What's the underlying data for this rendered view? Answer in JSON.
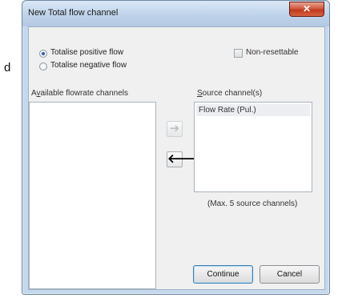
{
  "background_text": "d",
  "dialog": {
    "title": "New Total flow channel",
    "close_glyph": "✕",
    "radio_options": [
      {
        "label": "Totalise positive flow",
        "selected": true
      },
      {
        "label": "Totalise negative flow",
        "selected": false
      }
    ],
    "non_resettable": {
      "label": "Non-resettable",
      "checked": false
    },
    "available": {
      "label_prefix": "A",
      "label_mnemonic": "v",
      "label_rest": "ailable flowrate channels",
      "items": []
    },
    "source": {
      "label_mnemonic": "S",
      "label_rest": "ource channel(s)",
      "items": [
        "Flow Rate (Pul.)"
      ]
    },
    "add_arrow_glyph": "➔",
    "remove_arrow_glyph": "🡐",
    "max_note": "(Max. 5 source channels)",
    "continue_label": "Continue",
    "cancel_label": "Cancel"
  }
}
